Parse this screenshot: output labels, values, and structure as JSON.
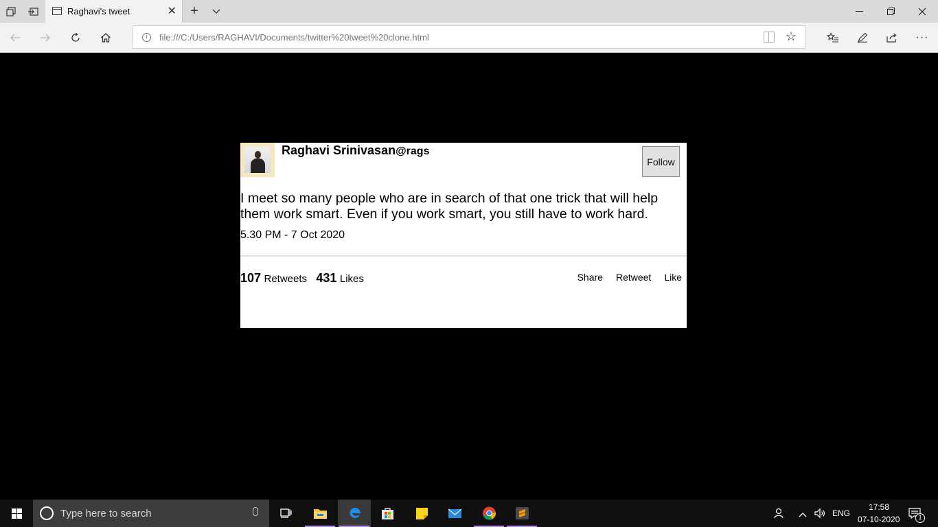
{
  "browser": {
    "tab": {
      "title": "Raghavi's tweet"
    },
    "address": {
      "url": "file:///C:/Users/RAGHAVI/Documents/twitter%20tweet%20clone.html"
    }
  },
  "tweet": {
    "author_name": "Raghavi Srinivasan",
    "author_handle": "@rags",
    "follow_label": "Follow",
    "text": "I meet so many people who are in search of that one trick that will help them work smart. Even if you work smart, you still have to work hard.",
    "timestamp": "5.30 PM - 7 Oct 2020",
    "retweets_count": "107",
    "retweets_label": "Retweets",
    "likes_count": "431",
    "likes_label": "Likes",
    "actions": {
      "share": "Share",
      "retweet": "Retweet",
      "like": "Like"
    }
  },
  "taskbar": {
    "search_placeholder": "Type here to search",
    "language": "ENG",
    "time": "17:58",
    "date": "07-10-2020",
    "notification_count": "1",
    "apps": [
      "task-view",
      "file-explorer",
      "edge",
      "store",
      "sticky-notes",
      "mail",
      "chrome",
      "sublime-text"
    ]
  },
  "colors": {
    "page_background": "#000000",
    "card_background": "#ffffff",
    "avatar_border": "#f6e7c0",
    "taskbar": "#101010",
    "taskbar_active_indicator": "#b58ee6"
  }
}
